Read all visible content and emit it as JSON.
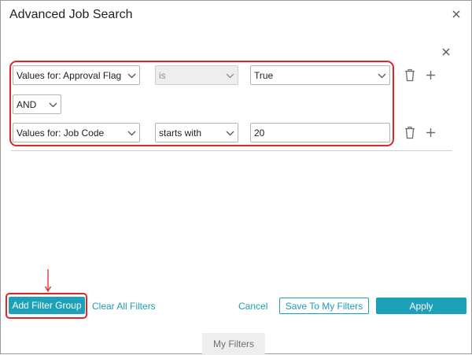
{
  "dialog": {
    "title": "Advanced Job Search"
  },
  "filters": {
    "row1": {
      "field_label": "Values for:  Approval Flag",
      "operator": "is",
      "value": "True"
    },
    "conjunction": "AND",
    "row2": {
      "field_label": "Values for:  Job Code",
      "operator": "starts with",
      "value": "20"
    }
  },
  "footer": {
    "add_filter_group": "Add Filter Group",
    "clear_all_filters": "Clear All Filters",
    "cancel": "Cancel",
    "save_to_my_filters": "Save To My Filters",
    "apply": "Apply",
    "my_filters_tab": "My Filters"
  },
  "colors": {
    "accent": "#1da1b9",
    "highlight": "#e0262b"
  },
  "icons": {
    "close": "close-icon",
    "remove_group": "close-icon",
    "delete": "trash-icon",
    "add": "plus-icon",
    "dropdown": "chevron-down-icon",
    "annotation": "arrow-down-icon"
  }
}
